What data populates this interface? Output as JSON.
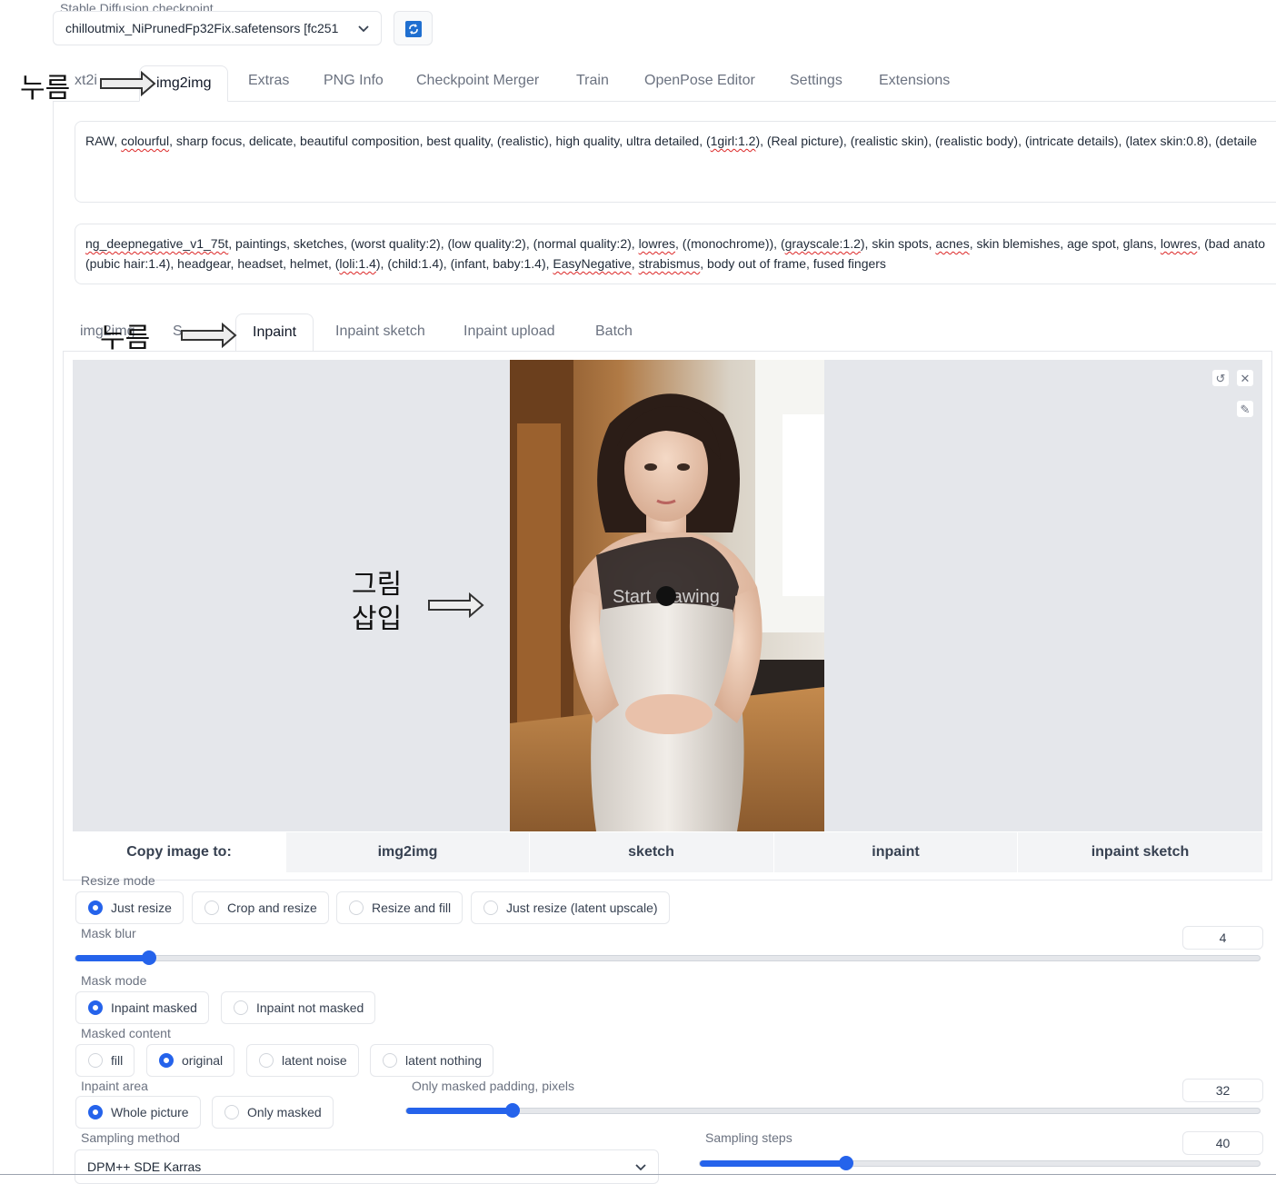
{
  "checkpoint": {
    "label": "Stable Diffusion checkpoint",
    "value": "chilloutmix_NiPrunedFp32Fix.safetensors [fc251"
  },
  "top_tabs": [
    "xt2i",
    "img2img",
    "Extras",
    "PNG Info",
    "Checkpoint Merger",
    "Train",
    "OpenPose Editor",
    "Settings",
    "Extensions"
  ],
  "prompt": {
    "positive": {
      "p1": "RAW, ",
      "w1": "colourful",
      "p2": ", sharp focus, delicate, beautiful composition, best quality, (realistic), high quality, ultra detailed, (",
      "w2": "1girl:1.2",
      "p3": "), (Real picture), (realistic skin), (realistic body), (intricate details), (latex skin:0.8), (detaile"
    },
    "negative": {
      "line1": {
        "w1": "ng_deepnegative_v1_75t",
        "p1": ", paintings, sketches, (worst quality:2), (low quality:2), (normal quality:2), ",
        "w2": "lowres",
        "p2": ", ((monochrome)), (",
        "w3": "grayscale:1.2",
        "p3": "), skin spots, ",
        "w4": "acnes",
        "p4": ", skin blemishes, age spot, glans, ",
        "w5": "lowres",
        "p5": ", (bad anato"
      },
      "line2": {
        "p1": "(pubic hair:1.4), headgear, headset, helmet, (",
        "w1": "loli:1.4",
        "p2": "), (child:1.4), (infant, baby:1.4), ",
        "w2": "EasyNegative",
        "p3": ", ",
        "w3": "strabismus",
        "p4": ", body out of frame, fused fingers"
      }
    }
  },
  "sub_tabs": [
    "img2img",
    "S",
    "Inpaint",
    "Inpaint sketch",
    "Inpaint upload",
    "Batch"
  ],
  "canvas": {
    "overlay_text": "Start drawing"
  },
  "copy_image": {
    "label": "Copy image to:",
    "buttons": [
      "img2img",
      "sketch",
      "inpaint",
      "inpaint sketch"
    ]
  },
  "resize_mode": {
    "label": "Resize mode",
    "options": [
      "Just resize",
      "Crop and resize",
      "Resize and fill",
      "Just resize (latent upscale)"
    ],
    "selected": "Just resize"
  },
  "mask_blur": {
    "label": "Mask blur",
    "value": "4",
    "min": 0,
    "max": 64
  },
  "mask_mode": {
    "label": "Mask mode",
    "options": [
      "Inpaint masked",
      "Inpaint not masked"
    ],
    "selected": "Inpaint masked"
  },
  "masked_content": {
    "label": "Masked content",
    "options": [
      "fill",
      "original",
      "latent noise",
      "latent nothing"
    ],
    "selected": "original"
  },
  "inpaint_area": {
    "label": "Inpaint area",
    "options": [
      "Whole picture",
      "Only masked"
    ],
    "selected": "Whole picture"
  },
  "only_masked_padding": {
    "label": "Only masked padding, pixels",
    "value": "32",
    "min": 0,
    "max": 256
  },
  "sampling_method": {
    "label": "Sampling method",
    "value": "DPM++ SDE Karras"
  },
  "sampling_steps": {
    "label": "Sampling steps",
    "value": "40",
    "min": 1,
    "max": 150
  },
  "annotations": {
    "press_1": "누름",
    "press_2": "누름",
    "insert_image_line1": "그림",
    "insert_image_line2": "삽입"
  },
  "colors": {
    "accent": "#2563eb",
    "panel_bg": "#e5e7eb"
  },
  "icons": [
    "refresh-icon",
    "chevron-down-icon",
    "undo-icon",
    "close-icon",
    "brush-icon"
  ]
}
